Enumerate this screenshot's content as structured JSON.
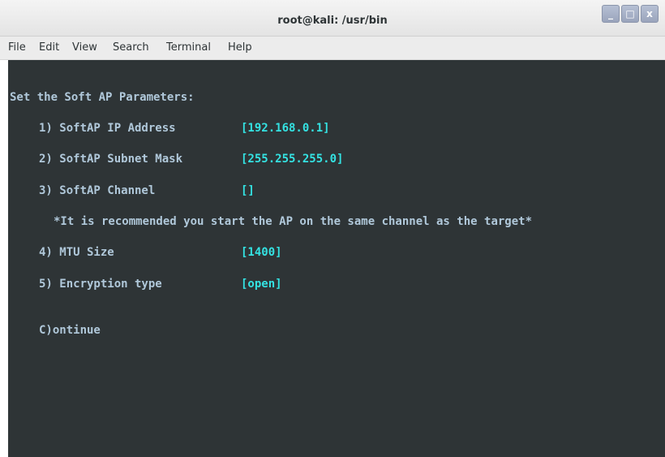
{
  "window": {
    "title": "root@kali: /usr/bin",
    "buttons": {
      "minimize_glyph": "_",
      "maximize_glyph": "□",
      "close_glyph": "x"
    }
  },
  "menubar": {
    "items": [
      "File",
      "Edit",
      "View",
      "Search",
      "Terminal",
      "Help"
    ]
  },
  "terminal": {
    "heading": "Set the Soft AP Parameters:",
    "options": [
      {
        "label": "1) SoftAP IP Address",
        "value": "[192.168.0.1]"
      },
      {
        "label": "2) SoftAP Subnet Mask",
        "value": "[255.255.255.0]"
      },
      {
        "label": "3) SoftAP Channel",
        "value": "[]"
      },
      {
        "label": "4) MTU Size",
        "value": "[1400]"
      },
      {
        "label": "5) Encryption type",
        "value": "[open]"
      }
    ],
    "recommendation": "*It is recommended you start the AP on the same channel as the target*",
    "continue": "C)ontinue"
  },
  "colors": {
    "terminal_background": "#2e3436",
    "terminal_text": "#b0c8da",
    "value_text": "#34e2e2",
    "titlebar": "#e9e9e9",
    "window_buttons": "#a8b2c8"
  }
}
